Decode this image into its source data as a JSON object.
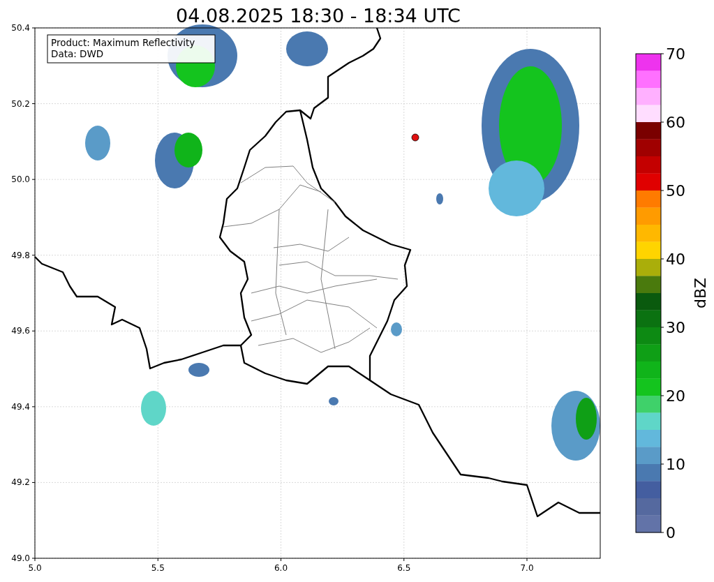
{
  "title": "04.08.2025 18:30 - 18:34 UTC",
  "info_box": {
    "lines": [
      "Product: Maximum Reflectivity",
      "Data: DWD"
    ]
  },
  "x_ticks": [
    "5.0",
    "5.5",
    "6.0",
    "6.5",
    "7.0"
  ],
  "y_ticks": [
    "50.4",
    "50.2",
    "50.0",
    "49.8",
    "49.6",
    "49.4",
    "49.2",
    "49.0"
  ],
  "colorbar": {
    "label": "dBZ",
    "ticks": [
      "70",
      "60",
      "50",
      "40",
      "30",
      "20",
      "10",
      "0"
    ],
    "bins": [
      {
        "color": "#ee33ee"
      },
      {
        "color": "#ff70ff"
      },
      {
        "color": "#ffb0ff"
      },
      {
        "color": "#ffddff"
      },
      {
        "color": "#7a0000"
      },
      {
        "color": "#a00000"
      },
      {
        "color": "#c40000"
      },
      {
        "color": "#e00000"
      },
      {
        "color": "#ff7b00"
      },
      {
        "color": "#ff9b00"
      },
      {
        "color": "#ffb800"
      },
      {
        "color": "#ffd400"
      },
      {
        "color": "#aaae0a"
      },
      {
        "color": "#4a7a0d"
      },
      {
        "color": "#0a5a0e"
      },
      {
        "color": "#0b7211"
      },
      {
        "color": "#0d8a13"
      },
      {
        "color": "#0f9f16"
      },
      {
        "color": "#10b41a"
      },
      {
        "color": "#14c41e"
      },
      {
        "color": "#3fd16a"
      },
      {
        "color": "#5fd6c8"
      },
      {
        "color": "#62b8dc"
      },
      {
        "color": "#5a9bc8"
      },
      {
        "color": "#4a79b0"
      },
      {
        "color": "#445ea0"
      },
      {
        "color": "#55699f"
      },
      {
        "color": "#6273a8"
      }
    ]
  }
}
